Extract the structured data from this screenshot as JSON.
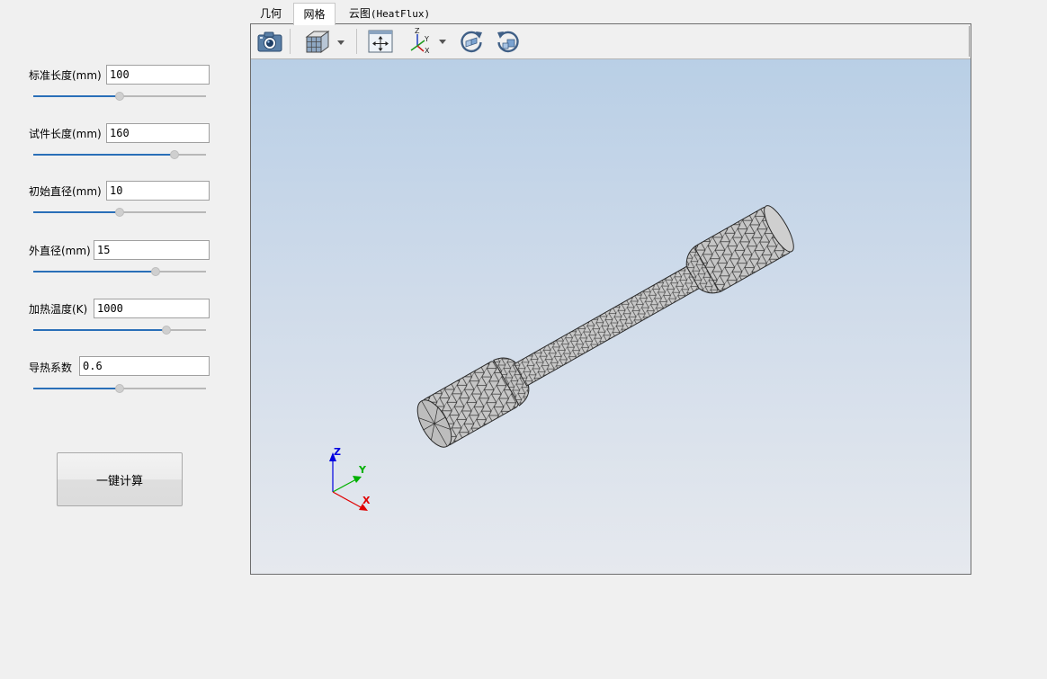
{
  "params": [
    {
      "label": "标准长度(mm)",
      "value": "100",
      "slider": 0.5
    },
    {
      "label": "试件长度(mm)",
      "value": "160",
      "slider": 0.82
    },
    {
      "label": "初始直径(mm)",
      "value": "10",
      "slider": 0.5
    },
    {
      "label": "外直径(mm)",
      "value": "15",
      "slider": 0.71
    },
    {
      "label": "加热温度(K)",
      "value": "1000",
      "slider": 0.77
    },
    {
      "label": "导热系数",
      "value": "0.6",
      "slider": 0.5
    }
  ],
  "calc_button": "一键计算",
  "tabs": [
    {
      "label": "几何",
      "active": false
    },
    {
      "label": "网格",
      "active": true
    },
    {
      "label": "云图",
      "suffix": "(HeatFlux)",
      "active": false
    }
  ],
  "toolbar": {
    "icons": [
      "camera-icon",
      "view-cube-icon",
      "fit-all-icon",
      "axes-icon",
      "rotate-cw-icon",
      "rotate-ccw-icon"
    ]
  },
  "triad": {
    "x_label": "X",
    "y_label": "Y",
    "z_label": "Z"
  },
  "colors": {
    "slider_fill": "#2a6fb8",
    "viewport_top": "#b9cfe6",
    "viewport_bottom": "#e6e9ee",
    "mesh_fill": "#c4c4c4",
    "mesh_edge": "#2a2a2a",
    "axis_x": "#e00000",
    "axis_y": "#00b000",
    "axis_z": "#0000e0"
  }
}
